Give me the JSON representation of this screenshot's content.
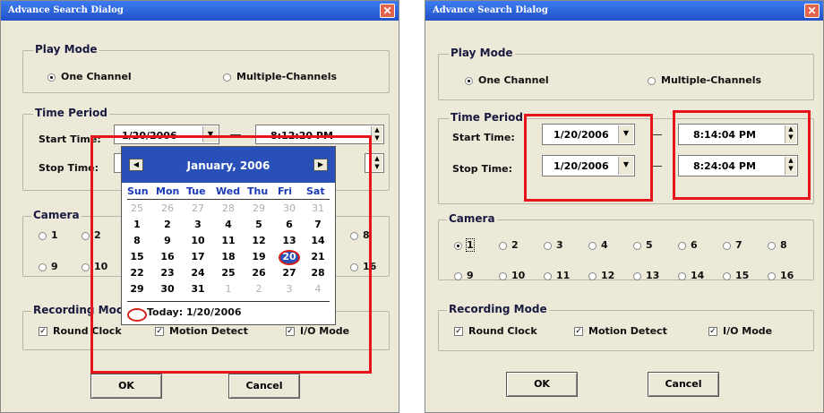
{
  "dialog_title": "Advance Search Dialog",
  "close_glyph": "✕",
  "play_mode": {
    "title": "Play Mode",
    "one_channel": "One Channel",
    "multiple_channels": "Multiple-Channels",
    "selected": "One Channel"
  },
  "time_period": {
    "title": "Time Period",
    "start_label": "Start Time:",
    "stop_label": "Stop Time:",
    "left": {
      "start_date": "1/20/2006",
      "start_time": "8:12:20 PM"
    },
    "right": {
      "start_date": "1/20/2006",
      "start_time": "8:14:04 PM",
      "stop_date": "1/20/2006",
      "stop_time": "8:24:04 PM"
    }
  },
  "camera": {
    "title": "Camera",
    "left_visible": [
      "1",
      "2",
      "8",
      "9",
      "10",
      "16"
    ],
    "items": [
      "1",
      "2",
      "3",
      "4",
      "5",
      "6",
      "7",
      "8",
      "9",
      "10",
      "11",
      "12",
      "13",
      "14",
      "15",
      "16"
    ],
    "selected": "1"
  },
  "recording_mode": {
    "title": "Recording Mode",
    "round_clock": "Round Clock",
    "motion_detect": "Motion Detect",
    "io_mode": "I/O Mode",
    "left_partial": "Recording Moc",
    "checked": true
  },
  "buttons": {
    "ok": "OK",
    "cancel": "Cancel"
  },
  "calendar": {
    "month_label": "January, 2006",
    "weekdays": [
      "Sun",
      "Mon",
      "Tue",
      "Wed",
      "Thu",
      "Fri",
      "Sat"
    ],
    "weeks": [
      [
        "25",
        "26",
        "27",
        "28",
        "29",
        "30",
        "31"
      ],
      [
        "1",
        "2",
        "3",
        "4",
        "5",
        "6",
        "7"
      ],
      [
        "8",
        "9",
        "10",
        "11",
        "12",
        "13",
        "14"
      ],
      [
        "15",
        "16",
        "17",
        "18",
        "19",
        "20",
        "21"
      ],
      [
        "22",
        "23",
        "24",
        "25",
        "26",
        "27",
        "28"
      ],
      [
        "29",
        "30",
        "31",
        "1",
        "2",
        "3",
        "4"
      ]
    ],
    "selected_day": "20",
    "today_label": "Today: 1/20/2006",
    "prev_glyph": "◀",
    "next_glyph": "▶"
  },
  "colors": {
    "highlight": "#e8141b",
    "title_bar": "#2a5bd7",
    "calendar_header": "#2850b8"
  }
}
